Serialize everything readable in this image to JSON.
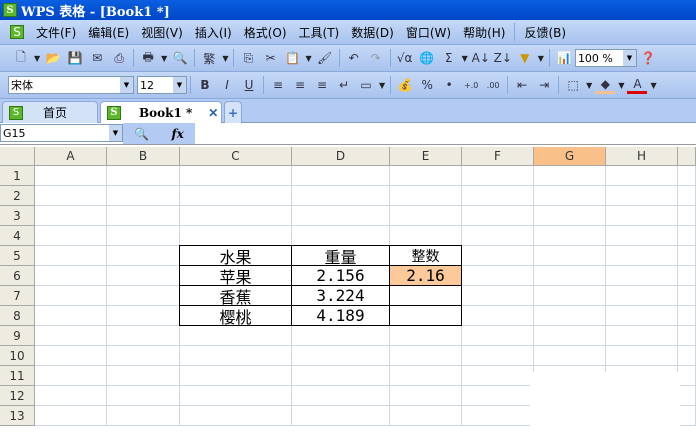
{
  "title": "WPS 表格 - [Book1 *]",
  "menu": [
    "文件(F)",
    "编辑(E)",
    "视图(V)",
    "插入(I)",
    "格式(O)",
    "工具(T)",
    "数据(D)",
    "窗口(W)",
    "帮助(H)",
    "反馈(B)"
  ],
  "toolbar": {
    "zoom": "100 %",
    "font": "宋体",
    "size": "12",
    "bold": "B",
    "italic": "I",
    "underline": "U",
    "trad": "繁",
    "percent": "%"
  },
  "tabs": [
    {
      "label": "首页"
    },
    {
      "label": "Book1 *"
    }
  ],
  "namebox": "G15",
  "fx": "fx",
  "columns": [
    "A",
    "B",
    "C",
    "D",
    "E",
    "F",
    "G",
    "H"
  ],
  "rows": [
    "1",
    "2",
    "3",
    "4",
    "5",
    "6",
    "7",
    "8",
    "9",
    "10",
    "11",
    "12",
    "13"
  ],
  "table": {
    "headers": [
      "水果",
      "重量",
      "整数"
    ],
    "rows": [
      [
        "苹果",
        "2.156",
        "2.16"
      ],
      [
        "香蕉",
        "3.224",
        ""
      ],
      [
        "樱桃",
        "4.189",
        ""
      ]
    ]
  },
  "colors": {
    "selected_col": "#f9c08a",
    "highlight_cell": "#fcc99a"
  }
}
